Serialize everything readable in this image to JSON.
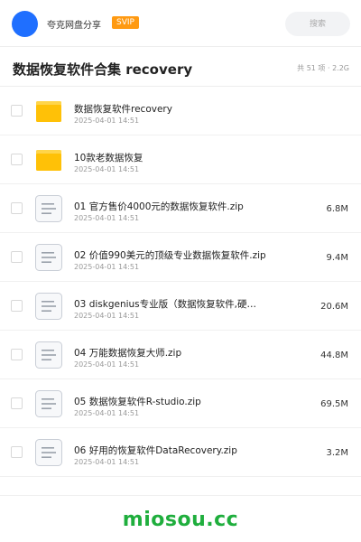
{
  "header": {
    "site_name": "夸克网盘分享",
    "badge": "SVIP",
    "search_placeholder": "搜索",
    "accent_color": "#1f6fff",
    "badge_color": "#ff9a12"
  },
  "share": {
    "title": "数据恢复软件合集 recovery",
    "meta": "共 51 项 · 2.2G"
  },
  "files": [
    {
      "type": "folder",
      "icon": "folder-icon",
      "name": "数据恢复软件recovery",
      "date": "2025-04-01 14:51",
      "size": ""
    },
    {
      "type": "folder",
      "icon": "folder-icon",
      "name": "10款老数据恢复",
      "date": "2025-04-01 14:51",
      "size": ""
    },
    {
      "type": "file",
      "icon": "document-icon",
      "name": "01 官方售价4000元的数据恢复软件.zip",
      "date": "2025-04-01 14:51",
      "size": "6.8M"
    },
    {
      "type": "file",
      "icon": "document-icon",
      "name": "02 价值990美元的顶级专业数据恢复软件.zip",
      "date": "2025-04-01 14:51",
      "size": "9.4M"
    },
    {
      "type": "file",
      "icon": "document-icon",
      "name": "03 diskgenius专业版（数据恢复软件,硬…",
      "date": "2025-04-01 14:51",
      "size": "20.6M"
    },
    {
      "type": "file",
      "icon": "document-icon",
      "name": "04 万能数据恢复大师.zip",
      "date": "2025-04-01 14:51",
      "size": "44.8M"
    },
    {
      "type": "file",
      "icon": "document-icon",
      "name": "05 数据恢复软件R-studio.zip",
      "date": "2025-04-01 14:51",
      "size": "69.5M"
    },
    {
      "type": "file",
      "icon": "document-icon",
      "name": "06 好用的恢复软件DataRecovery.zip",
      "date": "2025-04-01 14:51",
      "size": "3.2M"
    }
  ],
  "footer": {
    "brand": "miosou.cc",
    "brand_color": "#1fae3d"
  }
}
